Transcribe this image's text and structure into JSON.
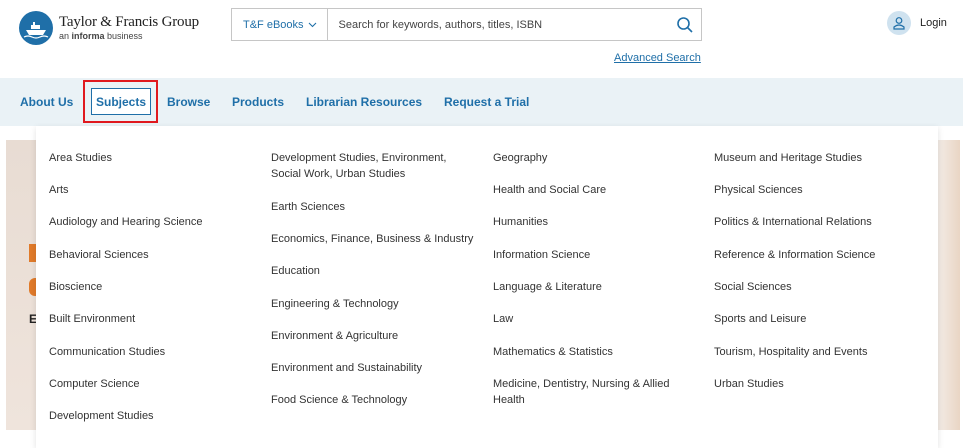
{
  "header": {
    "logo": {
      "title": "Taylor & Francis Group",
      "sub_prefix": "an ",
      "sub_brand": "informa",
      "sub_suffix": " business"
    },
    "search": {
      "category": "T&F eBooks",
      "placeholder": "Search for keywords, authors, titles, ISBN"
    },
    "advanced_search": "Advanced Search",
    "login": "Login"
  },
  "nav": {
    "items": [
      "About Us",
      "Subjects",
      "Browse",
      "Products",
      "Librarian Resources",
      "Request a Trial"
    ]
  },
  "background": {
    "initial": "E"
  },
  "subjects_menu": {
    "columns": [
      [
        "Area Studies",
        "Arts",
        "Audiology and Hearing Science",
        "Behavioral Sciences",
        "Bioscience",
        "Built Environment",
        "Communication Studies",
        "Computer Science",
        "Development Studies"
      ],
      [
        "Development Studies, Environment, Social Work, Urban Studies",
        "Earth Sciences",
        "Economics, Finance, Business & Industry",
        "Education",
        "Engineering & Technology",
        "Environment & Agriculture",
        "Environment and Sustainability",
        "Food Science & Technology"
      ],
      [
        "Geography",
        "Health and Social Care",
        "Humanities",
        "Information Science",
        "Language & Literature",
        "Law",
        "Mathematics & Statistics",
        "Medicine, Dentistry, Nursing & Allied Health"
      ],
      [
        "Museum and Heritage Studies",
        "Physical Sciences",
        "Politics & International Relations",
        "Reference & Information Science",
        "Social Sciences",
        "Sports and Leisure",
        "Tourism, Hospitality and Events",
        "Urban Studies"
      ]
    ]
  },
  "colors": {
    "brand_blue": "#1f6fa8",
    "nav_bg": "#eaf2f6",
    "highlight_red": "#e0191e"
  }
}
